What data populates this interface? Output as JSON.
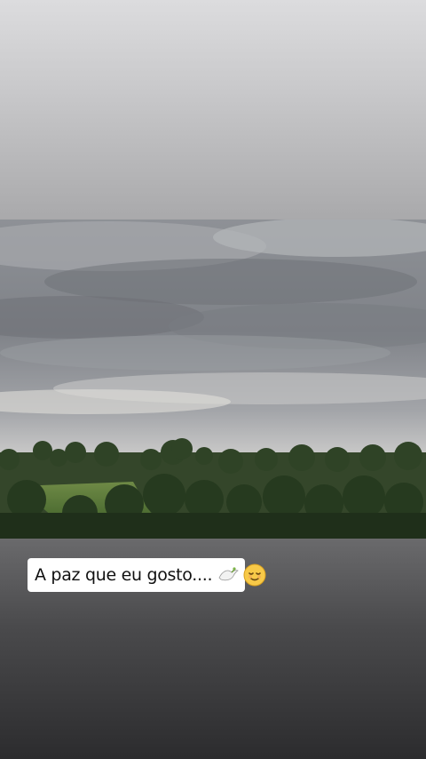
{
  "story": {
    "caption": {
      "text": "A paz que eu gosto....",
      "icons": [
        "dove-of-peace-icon",
        "relieved-face-icon"
      ]
    },
    "photo": {
      "subject": "cloudy sky over green forest"
    },
    "colors": {
      "top_fade": "#c9c9cb",
      "bottom_fade": "#3a3a3c",
      "caption_bg": "#ffffff",
      "caption_text": "#111111"
    }
  }
}
